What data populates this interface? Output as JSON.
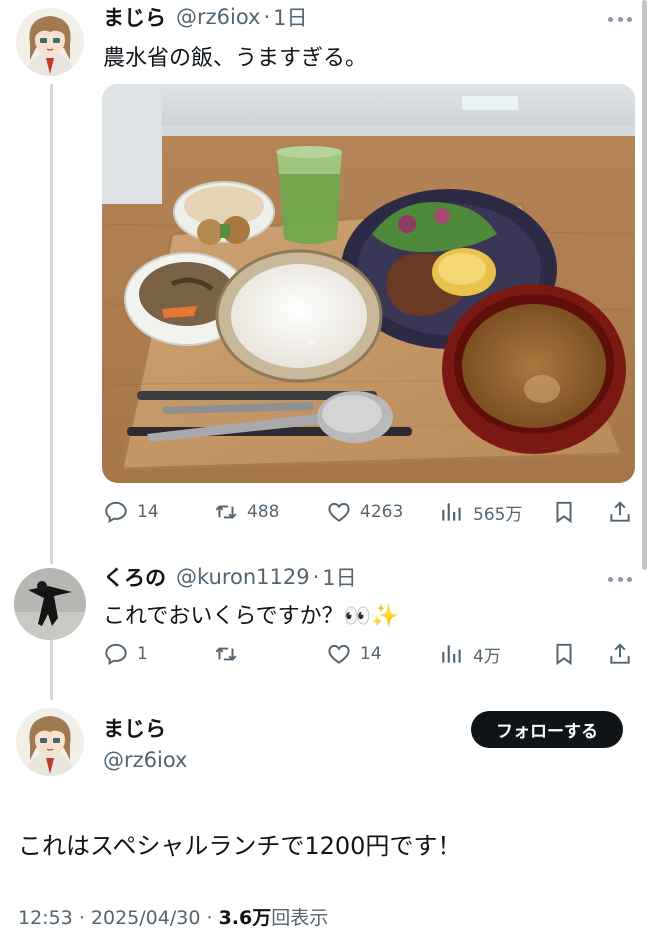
{
  "tweet1": {
    "name": "まじら",
    "handle": "@rz6iox",
    "dot": "·",
    "time": "1日",
    "text": "農水省の飯、うますぎる。",
    "photo_icon": "photo-lunch-tray",
    "stats": {
      "replies": "14",
      "retweets": "488",
      "likes": "4263",
      "views": "565万"
    }
  },
  "reply": {
    "name": "くろの",
    "handle": "@kuron1129",
    "dot": "·",
    "time": "1日",
    "text": "これでおいくらですか？👀✨",
    "stats": {
      "replies": "1",
      "retweets": "",
      "likes": "14",
      "views": "4万"
    }
  },
  "main": {
    "name": "まじら",
    "handle": "@rz6iox",
    "follow_label": "フォローする",
    "text": "これはスペシャルランチで1200円です！",
    "time": "12:53",
    "sep1": "·",
    "date": "2025/04/30",
    "sep2": "·",
    "views_count": "3.6万",
    "views_label": "回表示"
  },
  "icons": [
    "reply-icon",
    "retweet-icon",
    "like-icon",
    "views-icon",
    "bookmark-icon",
    "share-icon",
    "more-icon"
  ],
  "colors": {
    "text": "#0f1419",
    "secondary": "#536471",
    "thread": "#cfd9de",
    "follow_bg": "#0f1419"
  }
}
